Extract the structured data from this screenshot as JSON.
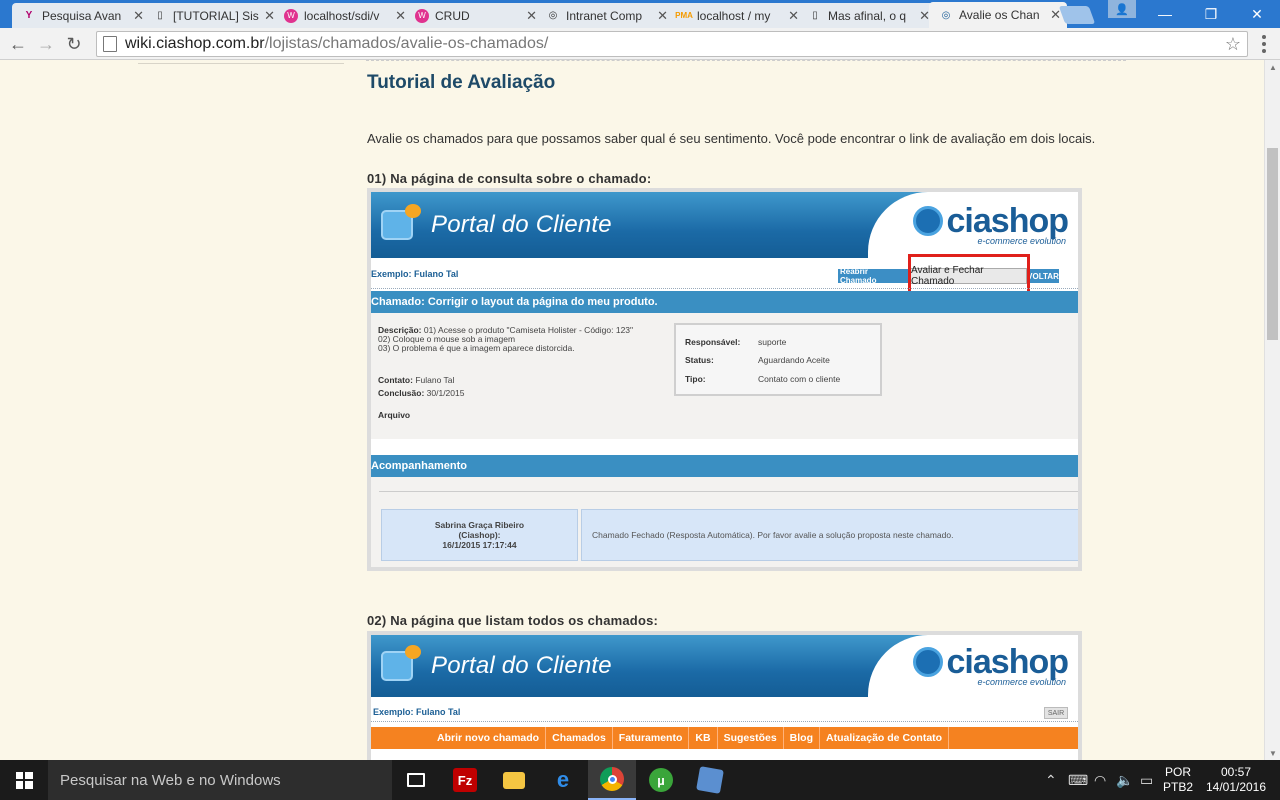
{
  "browser": {
    "tabs": [
      {
        "title": "Pesquisa Avan",
        "icon": "yahoo-icon",
        "color": "#7b0099"
      },
      {
        "title": "[TUTORIAL] Sis",
        "icon": "page-icon",
        "color": "#666666"
      },
      {
        "title": "localhost/sdi/v",
        "icon": "wamp-icon",
        "color": "#e0338f"
      },
      {
        "title": "CRUD",
        "icon": "wamp-icon",
        "color": "#e0338f"
      },
      {
        "title": "Intranet Comp",
        "icon": "globe-icon",
        "color": "#666666"
      },
      {
        "title": "localhost / my",
        "icon": "phpmyadmin-icon",
        "color": "#f59b00"
      },
      {
        "title": "Mas afinal, o q",
        "icon": "page-icon",
        "color": "#666666"
      },
      {
        "title": "Avalie os Chan",
        "icon": "globe-icon",
        "color": "#1a5d97"
      }
    ],
    "url_domain": "wiki.ciashop.com.br",
    "url_path": "/lojistas/chamados/avalie-os-chamados/"
  },
  "page": {
    "title": "Tutorial de Avaliação",
    "intro": "Avalie os chamados para que possamos saber qual é seu sentimento. Você pode encontrar o link de avaliação em dois locais.",
    "step1": "01) Na página de consulta sobre o chamado:",
    "step2": "02) Na página que listam todos os chamados:"
  },
  "shot1": {
    "portal_title": "Portal do Cliente",
    "brand": "ciashop",
    "brand_sub": "e-commerce evolution",
    "user": "Exemplo: Fulano Tal",
    "btn_reabrir": "Reabrir Chamado",
    "btn_avaliar": "Avaliar e Fechar Chamado",
    "btn_voltar": "VOLTAR",
    "chamado_bar": "Chamado: Corrigir o layout da página do meu produto.",
    "descricao_label": "Descrição:",
    "descricao_1": "01) Acesse o produto \"Camiseta Holister - Código: 123\"",
    "descricao_2": "02) Coloque o mouse sob a imagem",
    "descricao_3": "03) O problema é que a imagem aparece distorcida.",
    "contato_label": "Contato:",
    "contato_value": "Fulano Tal",
    "conclusao_label": "Conclusão:",
    "conclusao_value": "30/1/2015",
    "arquivo_label": "Arquivo",
    "responsavel_label": "Responsável:",
    "responsavel_value": "suporte",
    "status_label": "Status:",
    "status_value": "Aguardando Aceite",
    "tipo_label": "Tipo:",
    "tipo_value": "Contato com o cliente",
    "acompanhamento_bar": "Acompanhamento",
    "msg_author_1": "Sabrina Graça Ribeiro",
    "msg_author_2": "(Ciashop):",
    "msg_date": "16/1/2015 17:17:44",
    "msg_text": "Chamado Fechado (Resposta Automática). Por favor avalie a solução proposta neste chamado."
  },
  "shot2": {
    "portal_title": "Portal do Cliente",
    "brand": "ciashop",
    "brand_sub": "e-commerce evolution",
    "user": "Exemplo: Fulano Tal",
    "sair": "SAIR",
    "nav": [
      "Abrir novo chamado",
      "Chamados",
      "Faturamento",
      "KB",
      "Sugestões",
      "Blog",
      "Atualização de Contato"
    ]
  },
  "taskbar": {
    "search_placeholder": "Pesquisar na Web e no Windows",
    "lang_1": "POR",
    "lang_2": "PTB2",
    "time": "00:57",
    "date": "14/01/2016"
  }
}
